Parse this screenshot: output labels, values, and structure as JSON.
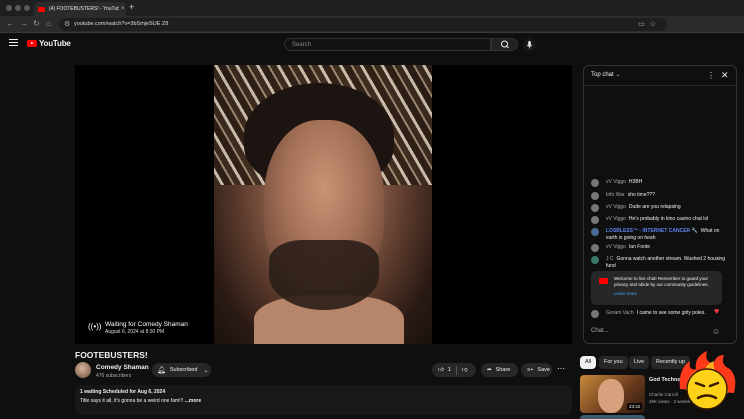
{
  "browser": {
    "tab_title": "(4) FOOTEBUSTERS! - YouTube",
    "url": "youtube.com/watch?v=3bSmjeSUE Z8",
    "new_tab": "+",
    "close_tab": "×"
  },
  "masthead": {
    "logo_text": "YouTube",
    "search_placeholder": "Search"
  },
  "player": {
    "waiting_title": "Waiting for Comedy Shaman",
    "waiting_date": "August 6, 2024 at 8:30 PM"
  },
  "video": {
    "title": "FOOTEBUSTERS!",
    "channel_name": "Comedy Shaman",
    "subscribers": "476 subscribers",
    "subscribe_label": "Subscribed",
    "like_count": "1",
    "share_label": "Share",
    "save_label": "Save",
    "description_line1": "1 waiting  Scheduled for Aug 6, 2024",
    "description_line2": "Title says it all, it's gonna be a weird one fam!!! ",
    "description_more": "...more"
  },
  "chat": {
    "mode_label": "Top chat",
    "input_placeholder": "Chat...",
    "messages": [
      {
        "author": "vV Viggo",
        "text": "H3BH"
      },
      {
        "author": "Info War",
        "text": "sho time???"
      },
      {
        "author": "vV Viggo",
        "text": "Dude are you relapsing"
      },
      {
        "author": "vV Viggo",
        "text": "He's probably in kino casino chat lol"
      },
      {
        "author": "LOSBLESS™ - INTERNET CANCER 🔧",
        "text": "What on earth is going on heah"
      },
      {
        "author": "vV Viggo",
        "text": "Ian Foote"
      },
      {
        "author": "J C",
        "text": "Gonna watch another stream. Washed 2 housing fund"
      },
      {
        "author": "Goram Vach",
        "text": "I came to see some girly poles."
      }
    ],
    "welcome_text": "Welcome to live chat! Remember to guard your privacy and abide by our community guidelines.",
    "learn_more": "Learn more"
  },
  "chips": [
    "All",
    "For you",
    "Live",
    "Recently up"
  ],
  "recommendation": {
    "title": "God Techno... of Things",
    "channel": "Charlie Carroll",
    "meta": "26K views · 2 weeks",
    "duration": "23:42"
  },
  "colors": {
    "accent": "#ff0000",
    "background": "#0f0f0f",
    "link": "#3ea6ff"
  }
}
